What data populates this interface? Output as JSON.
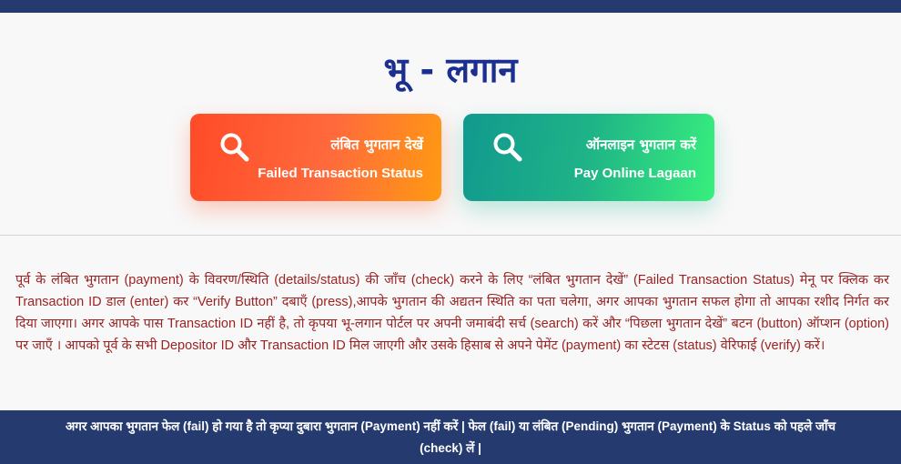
{
  "page": {
    "title": "भू - लगान"
  },
  "actions": [
    {
      "label_hi": "लंबित भुगतान देखें",
      "label_en": "Failed Transaction Status",
      "icon": "search-icon",
      "colors": [
        "#ff4b27",
        "#ff9a12"
      ]
    },
    {
      "label_hi": "ऑनलाइन भुगतान करें",
      "label_en": "Pay Online Lagaan",
      "icon": "search-icon",
      "colors": [
        "#11998e",
        "#38ef7d"
      ]
    }
  ],
  "description": "पूर्व के लंबित भुगतान (payment) के विवरण/स्थिति (details/status) की जाँच (check) करने के लिए “लंबित भुगतान देखें” (Failed Transaction Status) मेनू पर क्लिक कर Transaction ID डाल (enter) कर “Verify Button” दबाएँ (press),आपके भुगतान की अद्यतन स्थिति का पता चलेगा, अगर आपका भुगतान सफल होगा तो आपका रशीद निर्गत कर दिया जाएगा। अगर आपके पास Transaction ID नहीं है, तो कृपया भू-लगान पोर्टल पर अपनी जमाबंदी सर्च (search) करें और “पिछला भुगतान देखें” बटन (button) ऑप्शन (option) पर जाएँ । आपको पूर्व के सभी Depositor ID और Transaction ID मिल जाएगी और उसके हिसाब से अपने पेमेंट (payment) का स्टेटस (status) वेरिफाई (verify) करें।",
  "footer": {
    "notice": "अगर आपका भुगतान फेल (fail) हो गया है तो कृप्या दुबारा भुगतान (Payment) नहीं करें | फेल (fail) या लंबित (Pending) भुगतान (Payment) के Status को पहले जाँच (check) लें |"
  },
  "colors": {
    "header_bar": "#253a6e",
    "title": "#1a2f8f",
    "description_text": "#9b2323",
    "footer_bar": "#253a6e"
  }
}
